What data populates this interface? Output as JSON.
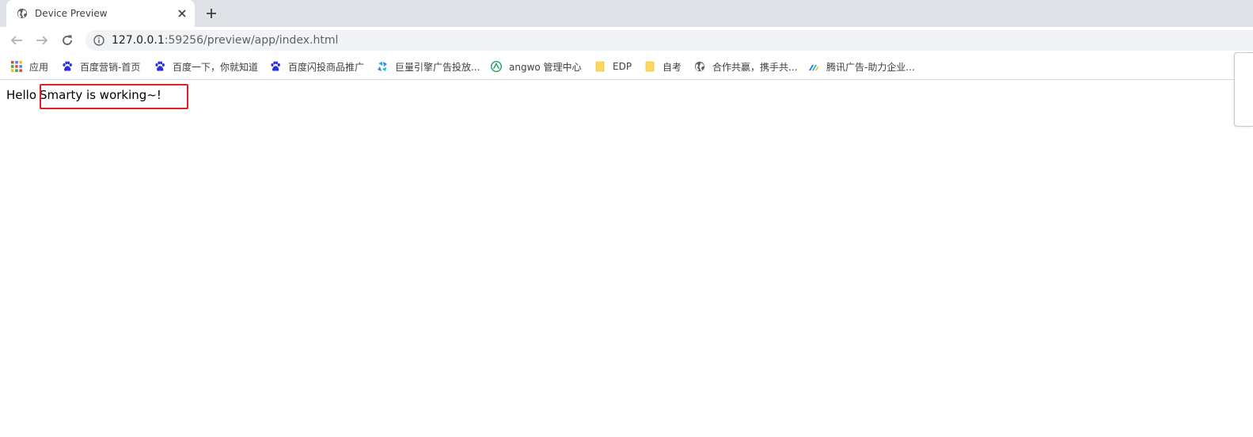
{
  "browser": {
    "tab": {
      "title": "Device Preview",
      "icon": "globe-icon"
    },
    "new_tab_label": "+",
    "address": {
      "host": "127.0.0.1",
      "rest": ":59256/preview/app/index.html"
    },
    "bookmarks": [
      {
        "label": "应用",
        "icon": "apps-grid-icon"
      },
      {
        "label": "百度营销-首页",
        "icon": "baidu-paw-icon"
      },
      {
        "label": "百度一下，你就知道",
        "icon": "baidu-paw-icon"
      },
      {
        "label": "百度闪投商品推广",
        "icon": "baidu-paw-icon"
      },
      {
        "label": "巨量引擎广告投放...",
        "icon": "oceanengine-icon"
      },
      {
        "label": "angwo 管理中心",
        "icon": "angwo-icon"
      },
      {
        "label": "EDP",
        "icon": "folder-icon"
      },
      {
        "label": "自考",
        "icon": "folder-icon"
      },
      {
        "label": "合作共赢，携手共...",
        "icon": "globe-icon"
      },
      {
        "label": "腾讯广告-助力企业...",
        "icon": "tencent-ads-icon"
      }
    ]
  },
  "page": {
    "hello": "Hello",
    "message": "Smarty is working~!"
  },
  "colors": {
    "tabstrip": "#dee1e6",
    "omnibox": "#f1f3f4",
    "highlight": "#e5201f",
    "folder": "#fdd663",
    "baidu": "#2932e1"
  }
}
